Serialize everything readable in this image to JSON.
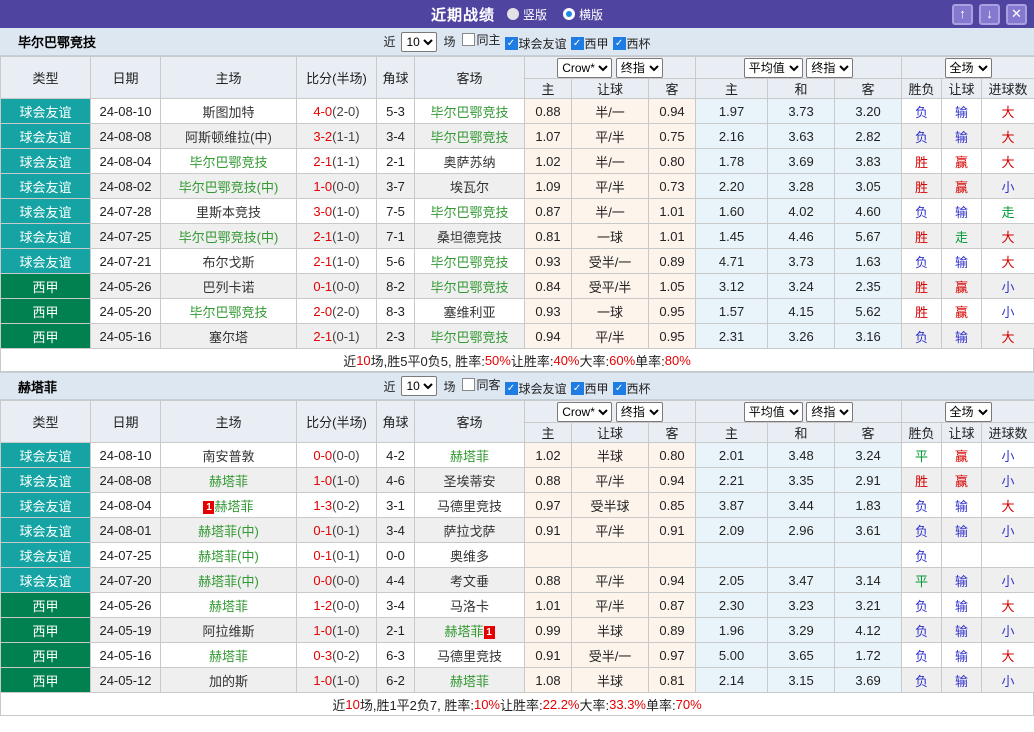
{
  "titlebar": {
    "title": "近期战绩",
    "radios": [
      {
        "label": "竖版",
        "selected": false
      },
      {
        "label": "横版",
        "selected": true
      }
    ],
    "up_icon": "↑",
    "down_icon": "↓",
    "close_icon": "✕"
  },
  "columns": {
    "type": "类型",
    "date": "日期",
    "home": "主场",
    "score": "比分(半场)",
    "corner": "角球",
    "away": "客场",
    "crow_sub": [
      "主",
      "让球",
      "客"
    ],
    "avg_sub": [
      "主",
      "和",
      "客"
    ],
    "result_sub": [
      "胜负",
      "让球",
      "进球数"
    ]
  },
  "selects": {
    "odds_source": "Crow*",
    "odds_ref": "终指",
    "avg": "平均值",
    "avg_ref": "终指",
    "scope": "全场"
  },
  "filter_labels": {
    "prefix": "近",
    "suffix": "场"
  },
  "sections": [
    {
      "team": "毕尔巴鄂竞技",
      "filter": {
        "count": "10",
        "checkboxes": [
          {
            "label": "同主",
            "checked": false
          },
          {
            "label": "球会友谊",
            "checked": true
          },
          {
            "label": "西甲",
            "checked": true
          },
          {
            "label": "西杯",
            "checked": true
          }
        ]
      },
      "rows": [
        {
          "type": "球会友谊",
          "date": "24-08-10",
          "home": {
            "name": "斯图加特",
            "focus": false
          },
          "score": "4-0",
          "half": "(2-0)",
          "corner": "5-3",
          "away": {
            "name": "毕尔巴鄂竞技",
            "focus": true
          },
          "odds": [
            "0.88",
            "半/一",
            "0.94"
          ],
          "avg": [
            "1.97",
            "3.73",
            "3.20"
          ],
          "results": [
            "负",
            "输",
            "大"
          ]
        },
        {
          "type": "球会友谊",
          "date": "24-08-08",
          "home": {
            "name": "阿斯顿维拉(中)",
            "focus": false
          },
          "score": "3-2",
          "half": "(1-1)",
          "corner": "3-4",
          "away": {
            "name": "毕尔巴鄂竞技",
            "focus": true
          },
          "odds": [
            "1.07",
            "平/半",
            "0.75"
          ],
          "avg": [
            "2.16",
            "3.63",
            "2.82"
          ],
          "results": [
            "负",
            "输",
            "大"
          ]
        },
        {
          "type": "球会友谊",
          "date": "24-08-04",
          "home": {
            "name": "毕尔巴鄂竞技",
            "focus": true
          },
          "score": "2-1",
          "half": "(1-1)",
          "corner": "2-1",
          "away": {
            "name": "奥萨苏纳",
            "focus": false
          },
          "odds": [
            "1.02",
            "半/一",
            "0.80"
          ],
          "avg": [
            "1.78",
            "3.69",
            "3.83"
          ],
          "results": [
            "胜",
            "赢",
            "大"
          ]
        },
        {
          "type": "球会友谊",
          "date": "24-08-02",
          "home": {
            "name": "毕尔巴鄂竞技(中)",
            "focus": true
          },
          "score": "1-0",
          "half": "(0-0)",
          "corner": "3-7",
          "away": {
            "name": "埃瓦尔",
            "focus": false
          },
          "odds": [
            "1.09",
            "平/半",
            "0.73"
          ],
          "avg": [
            "2.20",
            "3.28",
            "3.05"
          ],
          "results": [
            "胜",
            "赢",
            "小"
          ]
        },
        {
          "type": "球会友谊",
          "date": "24-07-28",
          "home": {
            "name": "里斯本竞技",
            "focus": false
          },
          "score": "3-0",
          "half": "(1-0)",
          "corner": "7-5",
          "away": {
            "name": "毕尔巴鄂竞技",
            "focus": true
          },
          "odds": [
            "0.87",
            "半/一",
            "1.01"
          ],
          "avg": [
            "1.60",
            "4.02",
            "4.60"
          ],
          "results": [
            "负",
            "输",
            "走"
          ]
        },
        {
          "type": "球会友谊",
          "date": "24-07-25",
          "home": {
            "name": "毕尔巴鄂竞技(中)",
            "focus": true
          },
          "score": "2-1",
          "half": "(1-0)",
          "corner": "7-1",
          "away": {
            "name": "桑坦德竞技",
            "focus": false
          },
          "odds": [
            "0.81",
            "一球",
            "1.01"
          ],
          "avg": [
            "1.45",
            "4.46",
            "5.67"
          ],
          "results": [
            "胜",
            "走",
            "大"
          ]
        },
        {
          "type": "球会友谊",
          "date": "24-07-21",
          "home": {
            "name": "布尔戈斯",
            "focus": false
          },
          "score": "2-1",
          "half": "(1-0)",
          "corner": "5-6",
          "away": {
            "name": "毕尔巴鄂竞技",
            "focus": true
          },
          "odds": [
            "0.93",
            "受半/一",
            "0.89"
          ],
          "avg": [
            "4.71",
            "3.73",
            "1.63"
          ],
          "results": [
            "负",
            "输",
            "大"
          ]
        },
        {
          "type": "西甲",
          "date": "24-05-26",
          "home": {
            "name": "巴列卡诺",
            "focus": false
          },
          "score": "0-1",
          "half": "(0-0)",
          "corner": "8-2",
          "away": {
            "name": "毕尔巴鄂竞技",
            "focus": true
          },
          "odds": [
            "0.84",
            "受平/半",
            "1.05"
          ],
          "avg": [
            "3.12",
            "3.24",
            "2.35"
          ],
          "results": [
            "胜",
            "赢",
            "小"
          ]
        },
        {
          "type": "西甲",
          "date": "24-05-20",
          "home": {
            "name": "毕尔巴鄂竞技",
            "focus": true
          },
          "score": "2-0",
          "half": "(2-0)",
          "corner": "8-3",
          "away": {
            "name": "塞维利亚",
            "focus": false
          },
          "odds": [
            "0.93",
            "一球",
            "0.95"
          ],
          "avg": [
            "1.57",
            "4.15",
            "5.62"
          ],
          "results": [
            "胜",
            "赢",
            "小"
          ]
        },
        {
          "type": "西甲",
          "date": "24-05-16",
          "home": {
            "name": "塞尔塔",
            "focus": false
          },
          "score": "2-1",
          "half": "(0-1)",
          "corner": "2-3",
          "away": {
            "name": "毕尔巴鄂竞技",
            "focus": true
          },
          "odds": [
            "0.94",
            "平/半",
            "0.95"
          ],
          "avg": [
            "2.31",
            "3.26",
            "3.16"
          ],
          "results": [
            "负",
            "输",
            "大"
          ]
        }
      ],
      "summary": [
        {
          "t": "近"
        },
        {
          "t": "10",
          "red": true
        },
        {
          "t": "场,胜5平0负5, 胜率:"
        },
        {
          "t": "50%",
          "red": true
        },
        {
          "t": " 让胜率:"
        },
        {
          "t": "40%",
          "red": true
        },
        {
          "t": " 大率:"
        },
        {
          "t": "60%",
          "red": true
        },
        {
          "t": " 单率:"
        },
        {
          "t": "80%",
          "red": true
        }
      ]
    },
    {
      "team": "赫塔菲",
      "filter": {
        "count": "10",
        "checkboxes": [
          {
            "label": "同客",
            "checked": false
          },
          {
            "label": "球会友谊",
            "checked": true
          },
          {
            "label": "西甲",
            "checked": true
          },
          {
            "label": "西杯",
            "checked": true
          }
        ]
      },
      "rows": [
        {
          "type": "球会友谊",
          "date": "24-08-10",
          "home": {
            "name": "南安普敦",
            "focus": false
          },
          "score": "0-0",
          "half": "(0-0)",
          "corner": "4-2",
          "away": {
            "name": "赫塔菲",
            "focus": true
          },
          "odds": [
            "1.02",
            "半球",
            "0.80"
          ],
          "avg": [
            "2.01",
            "3.48",
            "3.24"
          ],
          "results": [
            "平",
            "赢",
            "小"
          ]
        },
        {
          "type": "球会友谊",
          "date": "24-08-08",
          "home": {
            "name": "赫塔菲",
            "focus": true
          },
          "score": "1-0",
          "half": "(1-0)",
          "corner": "4-6",
          "away": {
            "name": "圣埃蒂安",
            "focus": false
          },
          "odds": [
            "0.88",
            "平/半",
            "0.94"
          ],
          "avg": [
            "2.21",
            "3.35",
            "2.91"
          ],
          "results": [
            "胜",
            "赢",
            "小"
          ]
        },
        {
          "type": "球会友谊",
          "date": "24-08-04",
          "home": {
            "name": "赫塔菲",
            "focus": true,
            "card": "1",
            "card_pos": "before"
          },
          "score": "1-3",
          "half": "(0-2)",
          "corner": "3-1",
          "away": {
            "name": "马德里竞技",
            "focus": false
          },
          "odds": [
            "0.97",
            "受半球",
            "0.85"
          ],
          "avg": [
            "3.87",
            "3.44",
            "1.83"
          ],
          "results": [
            "负",
            "输",
            "大"
          ]
        },
        {
          "type": "球会友谊",
          "date": "24-08-01",
          "home": {
            "name": "赫塔菲(中)",
            "focus": true
          },
          "score": "0-1",
          "half": "(0-1)",
          "corner": "3-4",
          "away": {
            "name": "萨拉戈萨",
            "focus": false
          },
          "odds": [
            "0.91",
            "平/半",
            "0.91"
          ],
          "avg": [
            "2.09",
            "2.96",
            "3.61"
          ],
          "results": [
            "负",
            "输",
            "小"
          ]
        },
        {
          "type": "球会友谊",
          "date": "24-07-25",
          "home": {
            "name": "赫塔菲(中)",
            "focus": true
          },
          "score": "0-1",
          "half": "(0-1)",
          "corner": "0-0",
          "away": {
            "name": "奥维多",
            "focus": false
          },
          "odds": [
            "",
            "",
            ""
          ],
          "avg": [
            "",
            "",
            ""
          ],
          "results": [
            "负",
            "",
            ""
          ]
        },
        {
          "type": "球会友谊",
          "date": "24-07-20",
          "home": {
            "name": "赫塔菲(中)",
            "focus": true
          },
          "score": "0-0",
          "half": "(0-0)",
          "corner": "4-4",
          "away": {
            "name": "考文垂",
            "focus": false
          },
          "odds": [
            "0.88",
            "平/半",
            "0.94"
          ],
          "avg": [
            "2.05",
            "3.47",
            "3.14"
          ],
          "results": [
            "平",
            "输",
            "小"
          ]
        },
        {
          "type": "西甲",
          "date": "24-05-26",
          "home": {
            "name": "赫塔菲",
            "focus": true
          },
          "score": "1-2",
          "half": "(0-0)",
          "corner": "3-4",
          "away": {
            "name": "马洛卡",
            "focus": false
          },
          "odds": [
            "1.01",
            "平/半",
            "0.87"
          ],
          "avg": [
            "2.30",
            "3.23",
            "3.21"
          ],
          "results": [
            "负",
            "输",
            "大"
          ]
        },
        {
          "type": "西甲",
          "date": "24-05-19",
          "home": {
            "name": "阿拉维斯",
            "focus": false
          },
          "score": "1-0",
          "half": "(1-0)",
          "corner": "2-1",
          "away": {
            "name": "赫塔菲",
            "focus": true,
            "card": "1",
            "card_pos": "after"
          },
          "odds": [
            "0.99",
            "半球",
            "0.89"
          ],
          "avg": [
            "1.96",
            "3.29",
            "4.12"
          ],
          "results": [
            "负",
            "输",
            "小"
          ]
        },
        {
          "type": "西甲",
          "date": "24-05-16",
          "home": {
            "name": "赫塔菲",
            "focus": true
          },
          "score": "0-3",
          "half": "(0-2)",
          "corner": "6-3",
          "away": {
            "name": "马德里竞技",
            "focus": false
          },
          "odds": [
            "0.91",
            "受半/一",
            "0.97"
          ],
          "avg": [
            "5.00",
            "3.65",
            "1.72"
          ],
          "results": [
            "负",
            "输",
            "大"
          ]
        },
        {
          "type": "西甲",
          "date": "24-05-12",
          "home": {
            "name": "加的斯",
            "focus": false
          },
          "score": "1-0",
          "half": "(1-0)",
          "corner": "6-2",
          "away": {
            "name": "赫塔菲",
            "focus": true
          },
          "odds": [
            "1.08",
            "半球",
            "0.81"
          ],
          "avg": [
            "2.14",
            "3.15",
            "3.69"
          ],
          "results": [
            "负",
            "输",
            "小"
          ]
        }
      ],
      "summary": [
        {
          "t": "近"
        },
        {
          "t": "10",
          "red": true
        },
        {
          "t": "场,胜1平2负7, 胜率:"
        },
        {
          "t": "10%",
          "red": true
        },
        {
          "t": " 让胜率:"
        },
        {
          "t": "22.2%",
          "red": true
        },
        {
          "t": " 大率:"
        },
        {
          "t": "33.3%",
          "red": true
        },
        {
          "t": " 单率:"
        },
        {
          "t": "70%",
          "red": true
        }
      ]
    }
  ]
}
